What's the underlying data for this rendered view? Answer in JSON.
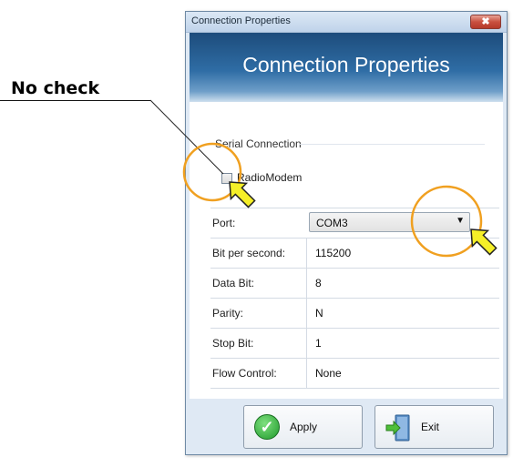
{
  "callout": {
    "text": "No check"
  },
  "window": {
    "title": "Connection Properties",
    "close_glyph": "✖",
    "banner_title": "Connection Properties"
  },
  "section": {
    "label": "Serial Connection"
  },
  "radiomodem": {
    "label": "RadioModem",
    "checked": false
  },
  "fields": [
    {
      "label": "Port:",
      "value": "COM3",
      "type": "dropdown"
    },
    {
      "label": "Bit per second:",
      "value": "115200"
    },
    {
      "label": "Data Bit:",
      "value": "8"
    },
    {
      "label": "Parity:",
      "value": "N"
    },
    {
      "label": "Stop Bit:",
      "value": "1"
    },
    {
      "label": "Flow Control:",
      "value": "None"
    }
  ],
  "buttons": {
    "apply": "Apply",
    "exit": "Exit"
  },
  "icons": {
    "apply": "checkmark-icon",
    "exit": "exit-door-icon",
    "dropdown": "chevron-down-icon",
    "pointer": "arrow-pointer-icon",
    "highlight": "highlight-circle"
  },
  "colors": {
    "highlight_ring": "#f0a020",
    "pointer_fill": "#f5ef28",
    "banner": "#2f6da5"
  }
}
